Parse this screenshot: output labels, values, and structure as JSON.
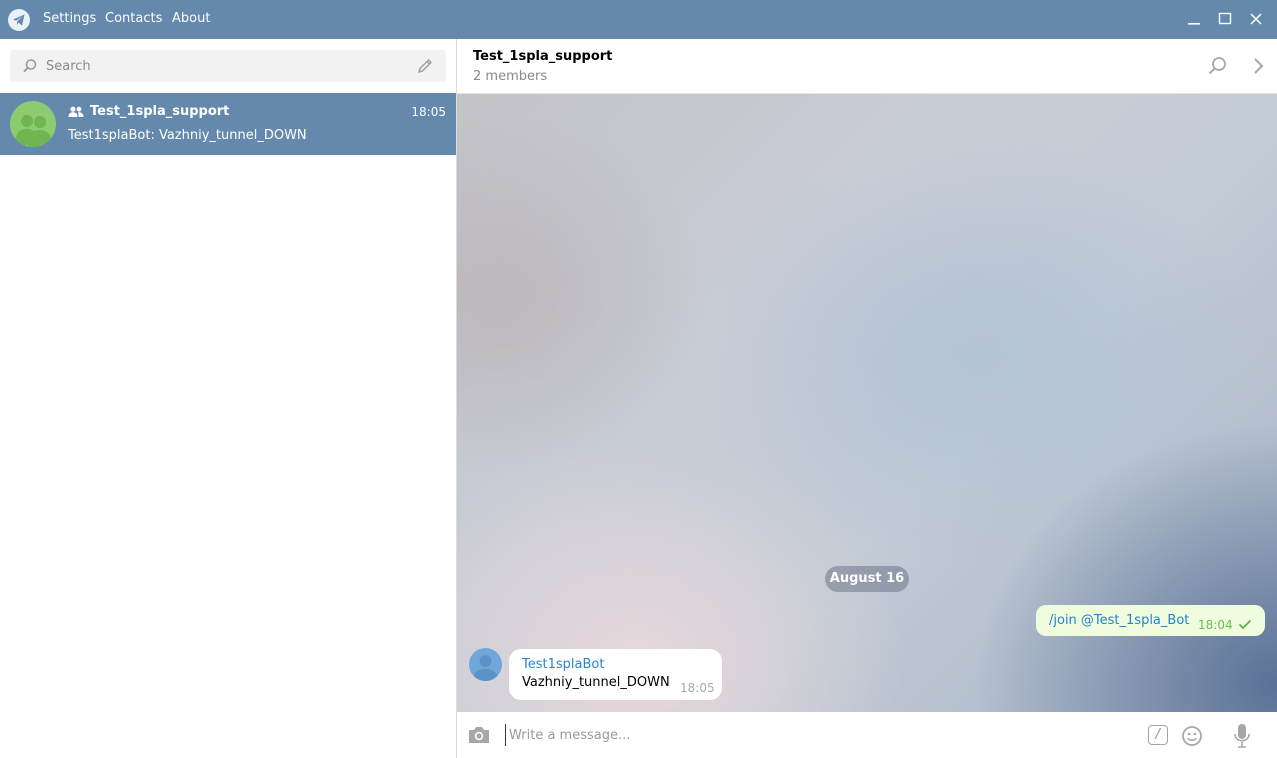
{
  "titlebar": {
    "menu": [
      {
        "label": "Settings"
      },
      {
        "label": "Contacts"
      },
      {
        "label": "About"
      }
    ],
    "icons": {
      "logo": "telegram-plane-icon",
      "minimize": "minimize-icon",
      "maximize": "maximize-icon",
      "close": "close-icon"
    }
  },
  "sidebar": {
    "search": {
      "placeholder": "Search",
      "value": ""
    },
    "dialogs": [
      {
        "name": "Test_1spla_support",
        "time": "18:05",
        "preview": "Test1splaBot: Vazhniy_tunnel_DOWN",
        "is_group": true,
        "selected": true
      }
    ]
  },
  "chat": {
    "title": "Test_1spla_support",
    "subtitle": "2 members",
    "date_separator": "August 16",
    "messages": [
      {
        "direction": "out",
        "text": "/join @Test_1spla_Bot",
        "time": "18:04",
        "status": "sent"
      },
      {
        "direction": "in",
        "sender": "Test1splaBot",
        "text": "Vazhniy_tunnel_DOWN",
        "time": "18:05"
      }
    ]
  },
  "composer": {
    "placeholder": "Write a message...",
    "value": "",
    "command_glyph": "/"
  },
  "colors": {
    "accent": "#6489ad",
    "avatar_group": "#8ccb6f",
    "avatar_bot": "#71a6d9",
    "outgoing_bubble": "#effdde",
    "link": "#2481cc"
  }
}
